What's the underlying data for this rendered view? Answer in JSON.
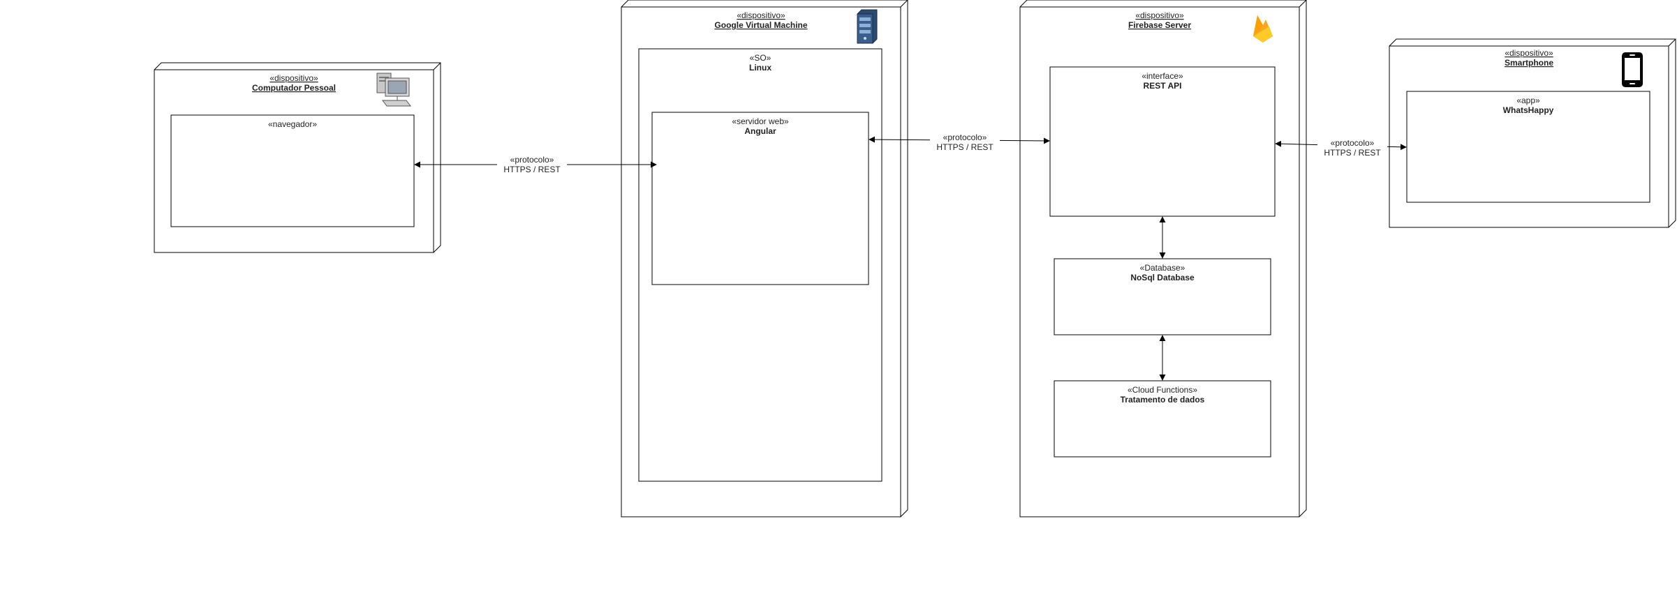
{
  "nodes": {
    "pc": {
      "stereotype": "«dispositivo»",
      "name": "Computador Pessoal",
      "icon": "desktop-computer-icon",
      "inner": {
        "stereotype": "«navegador»",
        "name": ""
      }
    },
    "gvm": {
      "stereotype": "«dispositivo»",
      "name": "Google Virtual Machine",
      "icon": "server-tower-icon",
      "os": {
        "stereotype": "«SO»",
        "name": "Linux"
      },
      "web": {
        "stereotype": "«servidor web»",
        "name": "Angular"
      }
    },
    "firebase": {
      "stereotype": "«dispositivo»",
      "name": "Firebase Server",
      "icon": "firebase-flame-icon",
      "api": {
        "stereotype": "«interface»",
        "name": "REST API"
      },
      "db": {
        "stereotype": "«Database»",
        "name": "NoSql Database"
      },
      "fn": {
        "stereotype": "«Cloud Functions»",
        "name": "Tratamento de dados"
      }
    },
    "phone": {
      "stereotype": "«dispositivo»",
      "name": "Smartphone",
      "icon": "smartphone-icon",
      "app": {
        "stereotype": "«app»",
        "name": "WhatsHappy"
      }
    }
  },
  "connectors": {
    "pc_gvm": {
      "stereotype": "«protocolo»",
      "label": "HTTPS / REST"
    },
    "gvm_firebase": {
      "stereotype": "«protocolo»",
      "label": "HTTPS / REST"
    },
    "firebase_phone": {
      "stereotype": "«protocolo»",
      "label": "HTTPS / REST"
    }
  },
  "colors": {
    "stroke": "#000000",
    "fill": "#ffffff",
    "firebase_orange": "#F5A623",
    "firebase_yellow": "#FFCA28",
    "server_blue": "#3a5f8f"
  }
}
